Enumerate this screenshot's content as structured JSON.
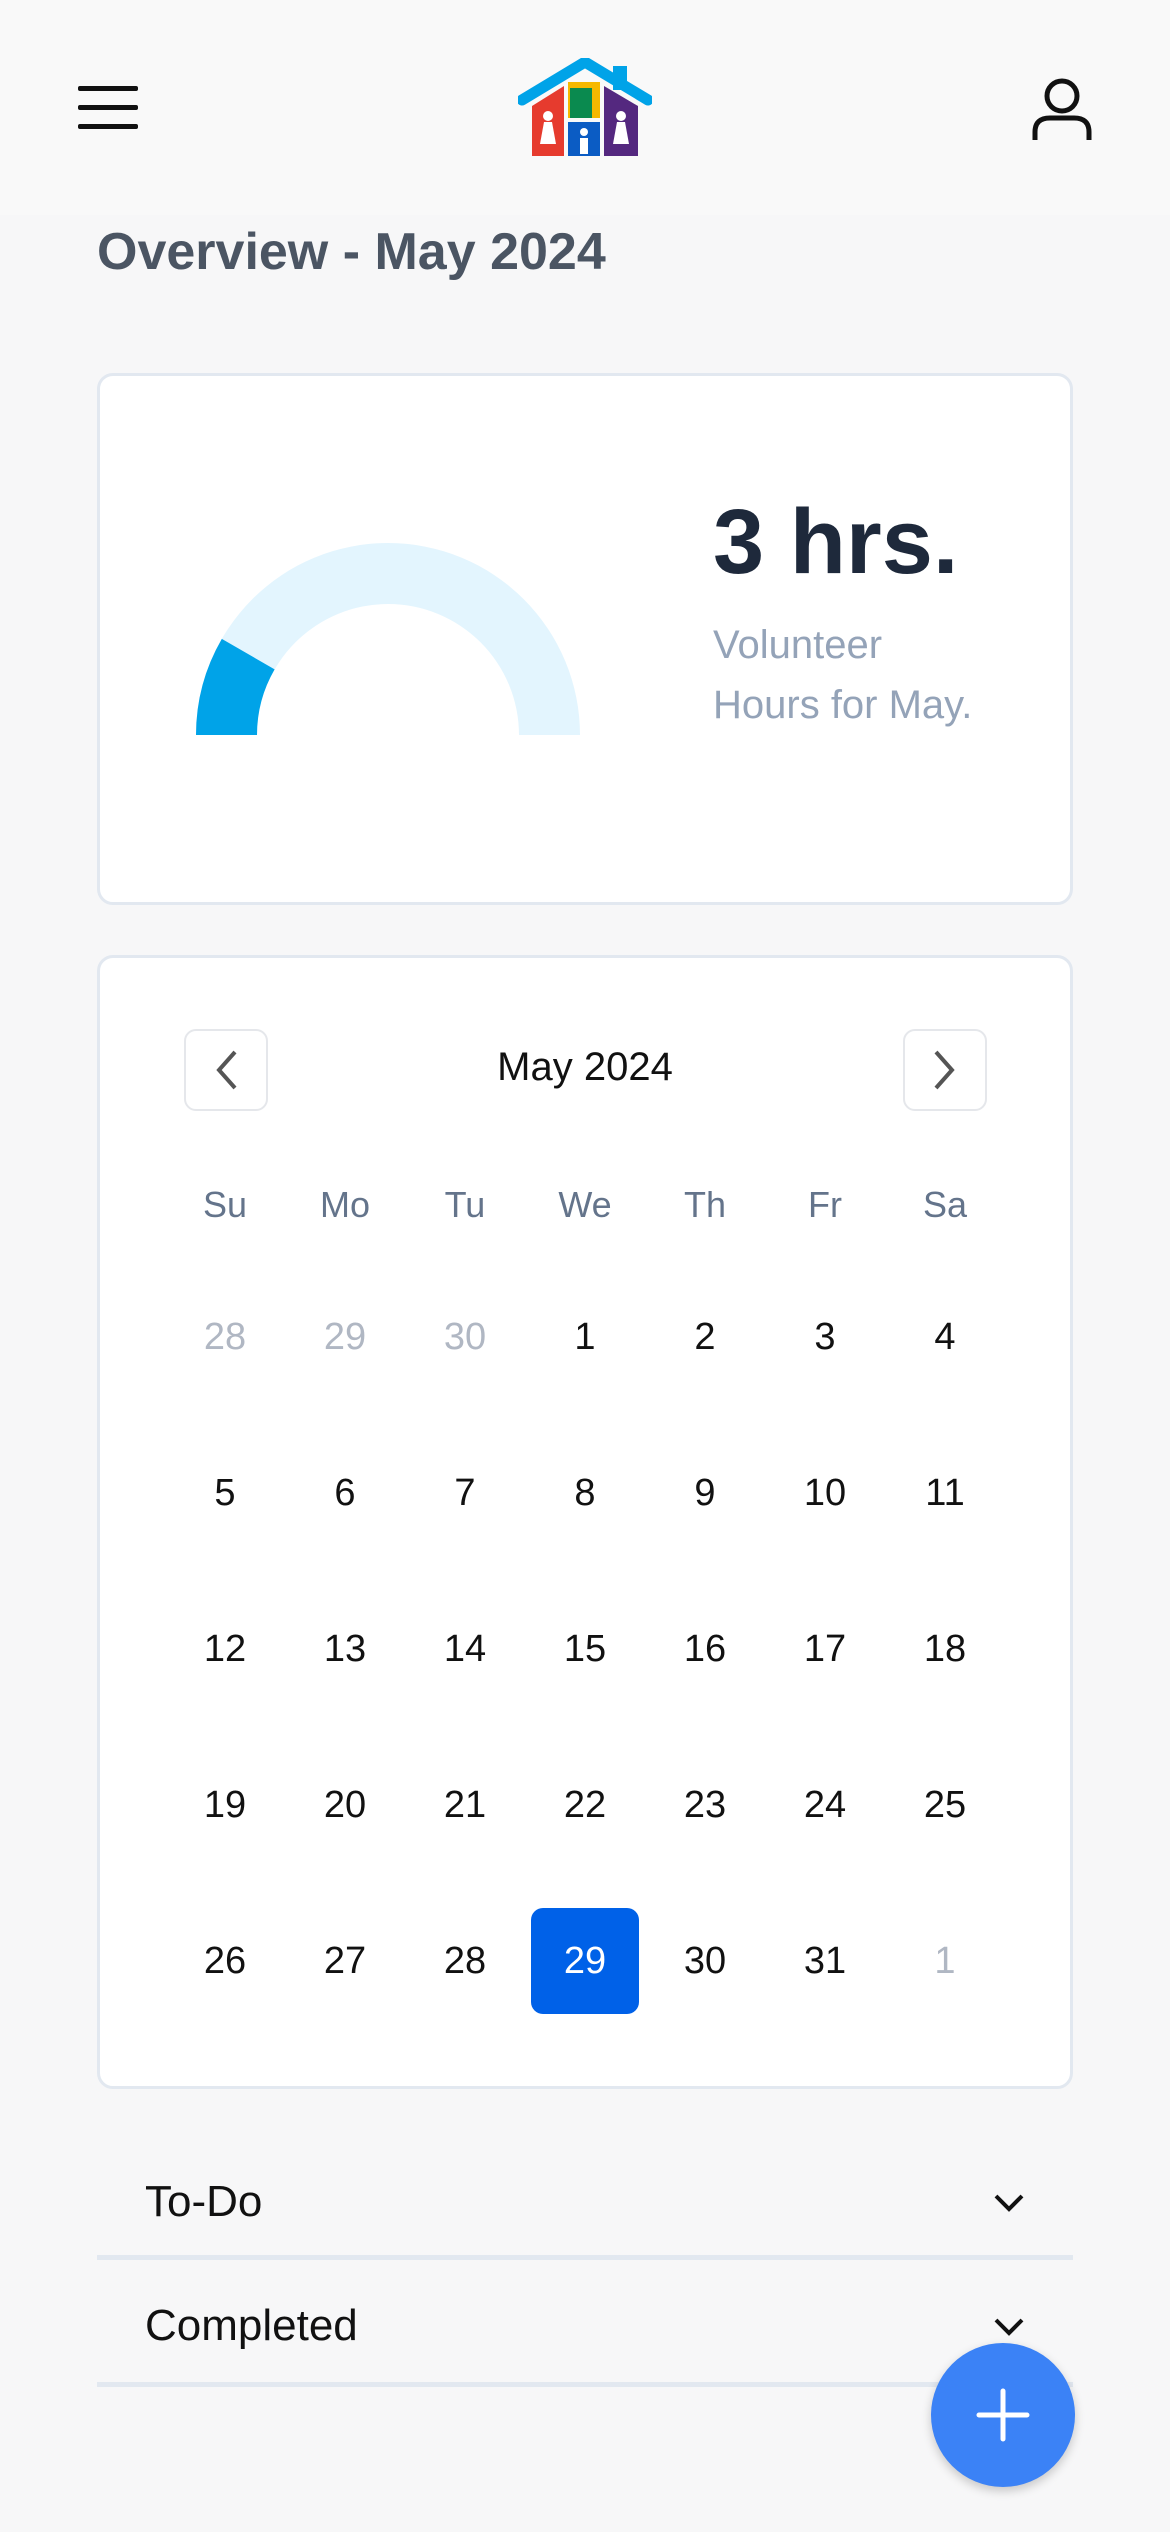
{
  "header": {
    "menu_icon": "hamburger-icon",
    "logo": "house-family-logo",
    "profile_icon": "user-icon"
  },
  "page_title": "Overview - May 2024",
  "hours_card": {
    "value": "3 hrs.",
    "label": "Volunteer Hours for May.",
    "gauge_fraction": 0.167,
    "gauge_color": "#00a3e8",
    "gauge_track_color": "#e3f5fe"
  },
  "calendar": {
    "month_label": "May 2024",
    "weekdays": [
      "Su",
      "Mo",
      "Tu",
      "We",
      "Th",
      "Fr",
      "Sa"
    ],
    "weeks": [
      [
        {
          "d": "28",
          "m": true
        },
        {
          "d": "29",
          "m": true
        },
        {
          "d": "30",
          "m": true
        },
        {
          "d": "1"
        },
        {
          "d": "2"
        },
        {
          "d": "3"
        },
        {
          "d": "4"
        }
      ],
      [
        {
          "d": "5"
        },
        {
          "d": "6"
        },
        {
          "d": "7"
        },
        {
          "d": "8"
        },
        {
          "d": "9"
        },
        {
          "d": "10"
        },
        {
          "d": "11"
        }
      ],
      [
        {
          "d": "12"
        },
        {
          "d": "13"
        },
        {
          "d": "14"
        },
        {
          "d": "15"
        },
        {
          "d": "16"
        },
        {
          "d": "17"
        },
        {
          "d": "18"
        }
      ],
      [
        {
          "d": "19"
        },
        {
          "d": "20"
        },
        {
          "d": "21"
        },
        {
          "d": "22"
        },
        {
          "d": "23"
        },
        {
          "d": "24"
        },
        {
          "d": "25"
        }
      ],
      [
        {
          "d": "26"
        },
        {
          "d": "27"
        },
        {
          "d": "28"
        },
        {
          "d": "29",
          "sel": true
        },
        {
          "d": "30"
        },
        {
          "d": "31"
        },
        {
          "d": "1",
          "m": true
        }
      ]
    ],
    "selected_color": "#0061e8"
  },
  "sections": [
    {
      "label": "To-Do"
    },
    {
      "label": "Completed"
    }
  ],
  "fab": {
    "icon": "plus-icon",
    "color": "#3b82f6"
  }
}
